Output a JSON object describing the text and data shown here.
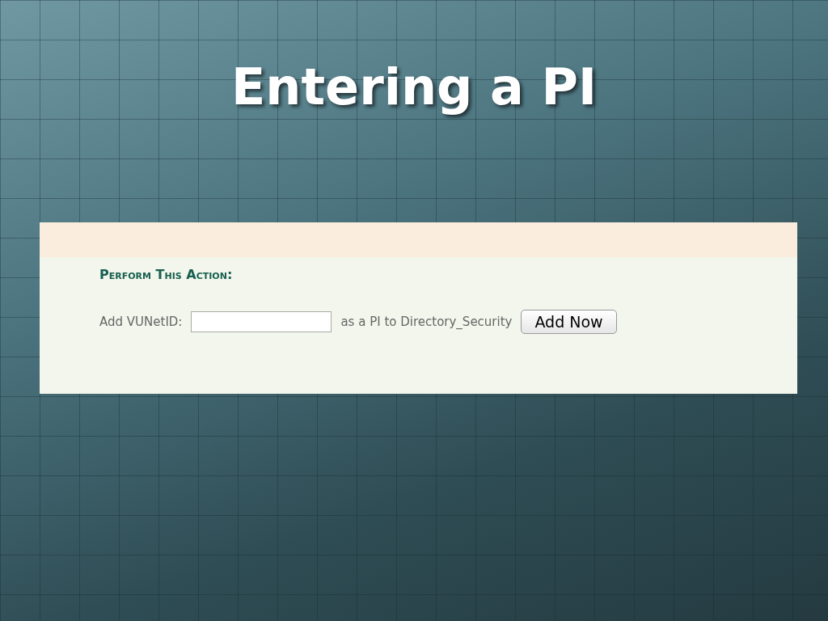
{
  "slide": {
    "title": "Entering a PI"
  },
  "form": {
    "heading": "Perform This Action:",
    "label": "Add VUNetID:",
    "suffix": "as a PI to Directory_Security",
    "button": "Add Now"
  }
}
